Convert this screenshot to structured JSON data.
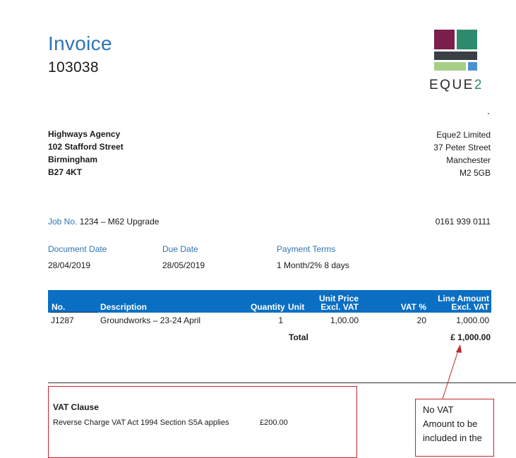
{
  "header": {
    "title": "Invoice",
    "invoice_number": "103038",
    "brand_text": "EQUE",
    "brand_suffix": "2"
  },
  "customer": {
    "line1": "Highways Agency",
    "line2": "102 Stafford Street",
    "line3": "Birmingham",
    "line4": "B27 4KT"
  },
  "company": {
    "line1": "Eque2 Limited",
    "line2": "37 Peter Street",
    "line3": "Manchester",
    "line4": "M2 5GB",
    "phone": "0161 939 0111"
  },
  "job": {
    "label": "Job No.",
    "value": "1234 – M62 Upgrade"
  },
  "dates": {
    "document_date_label": "Document Date",
    "document_date": "28/04/2019",
    "due_date_label": "Due Date",
    "due_date": "28/05/2019",
    "payment_terms_label": "Payment Terms",
    "payment_terms": "1 Month/2% 8 days"
  },
  "table": {
    "headers": {
      "no": "No.",
      "description": "Description",
      "quantity": "Quantity",
      "unit": "Unit",
      "unit_price_1": "Unit Price",
      "unit_price_2": "Excl. VAT",
      "vat": "VAT %",
      "line_amount_1": "Line Amount",
      "line_amount_2": "Excl. VAT"
    },
    "rows": [
      {
        "no": "J1287",
        "description": "Groundworks – 23-24 April",
        "quantity": "1",
        "unit": "",
        "unit_price": "1,00.00",
        "vat": "20",
        "line_amount": "1,000.00"
      }
    ],
    "total_label": "Total",
    "total_value": "£ 1,000.00"
  },
  "vat_clause": {
    "title": "VAT Clause",
    "text": "Reverse Charge VAT Act 1994 Section S5A applies",
    "amount": "£200.00"
  },
  "annotation": {
    "line1": "No VAT",
    "line2": "Amount to be",
    "line3": "included in the"
  },
  "colors": {
    "accent_blue": "#2e74b5",
    "table_header": "#0a6fc2",
    "logo_purple": "#7b1f4c",
    "logo_green": "#2e8b6e",
    "logo_dark": "#3a3f44",
    "logo_lime": "#a6cf86",
    "logo_blue": "#4a90d0",
    "annotation_red": "#c0262d"
  }
}
